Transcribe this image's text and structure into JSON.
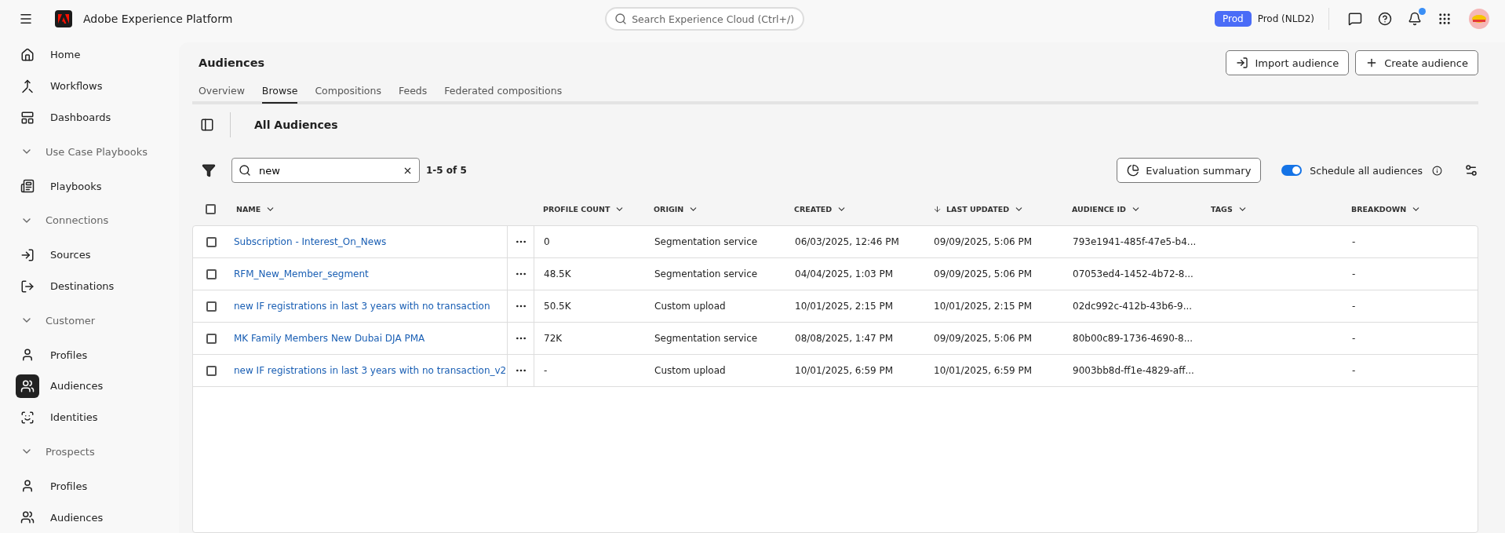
{
  "app": {
    "title": "Adobe Experience Platform",
    "search": {
      "placeholder": "Search Experience Cloud (Ctrl+/)"
    },
    "environment": {
      "badge": "Prod",
      "name": "Prod (NLD2)"
    },
    "notifications": {
      "unread": true
    }
  },
  "sidebar": [
    {
      "kind": "item",
      "label": "Home",
      "selected": false
    },
    {
      "kind": "item",
      "label": "Workflows",
      "selected": false
    },
    {
      "kind": "item",
      "label": "Dashboards",
      "selected": false
    },
    {
      "kind": "section",
      "label": "Use Case Playbooks"
    },
    {
      "kind": "item",
      "label": "Playbooks",
      "selected": false
    },
    {
      "kind": "section",
      "label": "Connections"
    },
    {
      "kind": "item",
      "label": "Sources",
      "selected": false
    },
    {
      "kind": "item",
      "label": "Destinations",
      "selected": false
    },
    {
      "kind": "section",
      "label": "Customer"
    },
    {
      "kind": "item",
      "label": "Profiles",
      "selected": false
    },
    {
      "kind": "item",
      "label": "Audiences",
      "selected": true
    },
    {
      "kind": "item",
      "label": "Identities",
      "selected": false
    },
    {
      "kind": "section",
      "label": "Prospects"
    },
    {
      "kind": "item",
      "label": "Profiles",
      "selected": false
    },
    {
      "kind": "item",
      "label": "Audiences",
      "selected": false
    }
  ],
  "page": {
    "title": "Audiences",
    "buttons": [
      {
        "label": "Import audience"
      },
      {
        "label": "Create audience"
      }
    ],
    "tabs": [
      {
        "label": "Overview",
        "selected": false
      },
      {
        "label": "Browse",
        "selected": true
      },
      {
        "label": "Compositions",
        "selected": false
      },
      {
        "label": "Feeds",
        "selected": false
      },
      {
        "label": "Federated compositions",
        "selected": false
      }
    ],
    "section_title": "All Audiences",
    "filter": {
      "value": "new",
      "count": "1-5 of 5"
    },
    "evaluation_button": "Evaluation summary",
    "schedule_toggle": {
      "label": "Schedule all audiences",
      "on": true
    }
  },
  "table": {
    "select_all_checked": false,
    "columns": [
      {
        "label": "NAME",
        "sorted": false
      },
      {
        "label": "PROFILE COUNT",
        "sorted": false
      },
      {
        "label": "ORIGIN",
        "sorted": false
      },
      {
        "label": "CREATED",
        "sorted": false
      },
      {
        "label": "LAST UPDATED",
        "sorted": true
      },
      {
        "label": "AUDIENCE ID",
        "sorted": false
      },
      {
        "label": "TAGS",
        "sorted": false
      },
      {
        "label": "BREAKDOWN",
        "sorted": false
      }
    ],
    "rows": [
      {
        "checked": false,
        "name": "Subscription - Interest_On_News",
        "profile_count": "0",
        "origin": "Segmentation service",
        "created": "06/03/2025, 12:46 PM",
        "last_updated": "09/09/2025, 5:06 PM",
        "audience_id": "793e1941-485f-47e5-b4...",
        "breakdown": "-"
      },
      {
        "checked": false,
        "name": "RFM_New_Member_segment",
        "profile_count": "48.5K",
        "origin": "Segmentation service",
        "created": "04/04/2025, 1:03 PM",
        "last_updated": "09/09/2025, 5:06 PM",
        "audience_id": "07053ed4-1452-4b72-8...",
        "breakdown": "-"
      },
      {
        "checked": false,
        "name": "new IF registrations in last 3 years with no transaction",
        "profile_count": "50.5K",
        "origin": "Custom upload",
        "created": "10/01/2025, 2:15 PM",
        "last_updated": "10/01/2025, 2:15 PM",
        "audience_id": "02dc992c-412b-43b6-9...",
        "breakdown": "-"
      },
      {
        "checked": false,
        "name": "MK Family Members New Dubai DJA PMA",
        "profile_count": "72K",
        "origin": "Segmentation service",
        "created": "08/08/2025, 1:47 PM",
        "last_updated": "09/09/2025, 5:06 PM",
        "audience_id": "80b00c89-1736-4690-8...",
        "breakdown": "-"
      },
      {
        "checked": false,
        "name": "new IF registrations in last 3 years with no transaction_v2",
        "profile_count": "-",
        "origin": "Custom upload",
        "created": "10/01/2025, 6:59 PM",
        "last_updated": "10/01/2025, 6:59 PM",
        "audience_id": "9003bb8d-ff1e-4829-aff...",
        "breakdown": "-"
      }
    ]
  }
}
